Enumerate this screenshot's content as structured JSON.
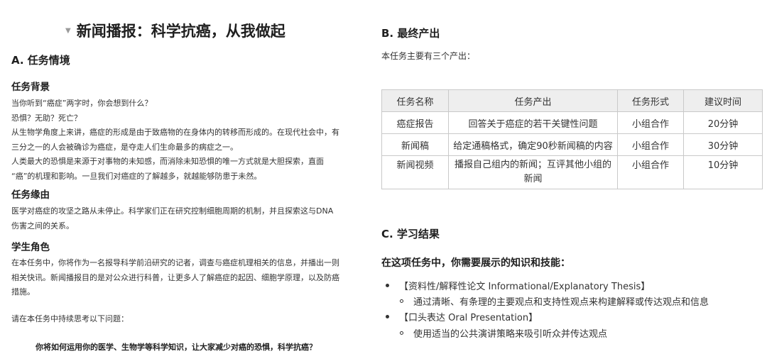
{
  "doc_title": "新闻播报：科学抗癌，从我做起",
  "section_a": {
    "heading": "A. 任务情境",
    "background": {
      "heading": "任务背景",
      "lines": [
        "当你听到“癌症”两字时，你会想到什么？",
        "恐惧？无助？死亡？",
        "从生物学角度上来讲，癌症的形成是由于致癌物的在身体内的转移而形成的。在现代社会中，有",
        "三分之一的人会被确诊为癌症，是夺走人们生命最多的病症之一。",
        "人类最大的恐惧是来源于对事物的未知感，而消除未知恐惧的唯一方式就是大胆探索，直面",
        "“癌”的机理和影响。一旦我们对癌症的了解越多，就越能够防患于未然。"
      ]
    },
    "reason": {
      "heading": "任务缘由",
      "lines": [
        "医学对癌症的攻坚之路从未停止。科学家们正在研究控制细胞周期的机制，并且探索这与DNA",
        "伤害之间的关系。"
      ]
    },
    "role": {
      "heading": "学生角色",
      "lines": [
        "在本任务中，你将作为一名报导科学前沿研究的记者，调查与癌症机理相关的信息，并播出一则",
        "相关快讯。新闻播报目的是对公众进行科普，让更多人了解癌症的起因、细胞学原理，以及防癌",
        "措施。"
      ]
    },
    "think_prompt": "请在本任务中持续思考以下问题：",
    "driving_question": "你将如何运用你的医学、生物学等科学知识，让大家减少对癌的恐惧，科学抗癌？"
  },
  "section_b": {
    "heading": "B. 最终产出",
    "intro": "本任务主要有三个产出：",
    "table": {
      "headers": [
        "任务名称",
        "任务产出",
        "任务形式",
        "建议时间"
      ],
      "rows": [
        [
          "癌症报告",
          "回答关于癌症的若干关键性问题",
          "小组合作",
          "20分钟"
        ],
        [
          "新闻稿",
          "给定通稿格式，确定90秒新闻稿的内容",
          "小组合作",
          "30分钟"
        ],
        [
          "新闻视频",
          "播报自己组内的新闻；互评其他小组的",
          "小组合作",
          "10分钟"
        ]
      ],
      "row3_output_line2": "新闻"
    }
  },
  "section_c": {
    "heading": "C. 学习结果",
    "skills_heading": "在这项任务中，你需要展示的知识和技能：",
    "items": [
      {
        "label": "【资料性/解释性论文 Informational/Explanatory Thesis】",
        "sub": "通过清晰、有条理的主要观点和支持性观点来构建解释或传达观点和信息"
      },
      {
        "label": "【口头表达 Oral Presentation】",
        "sub": "使用适当的公共演讲策略来吸引听众并传达观点"
      }
    ]
  }
}
